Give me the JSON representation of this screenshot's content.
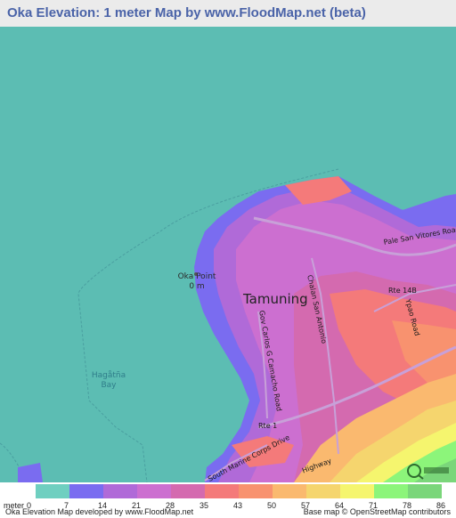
{
  "title": "Oka Elevation: 1 meter Map by www.FloodMap.net (beta)",
  "map": {
    "labels": {
      "point_name": "Oka Point",
      "point_elevation": "0 m",
      "bay": "Hagåtña\nBay",
      "city": "Tamuning"
    },
    "roads": {
      "pale_san_vitores": "Pale San Vitores Road",
      "chalan_san_antonio": "Chalan San Antonio",
      "gov_carlos": "Gov Carlos G Camacho Road",
      "rte_14b": "Rte 14B",
      "ypao": "Ypao Road",
      "rte_1": "Rte 1",
      "south_marine": "South Marine Corps Drive",
      "highway": "Highway"
    },
    "icons": [
      "osm-logo-icon"
    ]
  },
  "legend": {
    "unit_label": "meter",
    "ticks": [
      "0",
      "7",
      "14",
      "21",
      "28",
      "35",
      "43",
      "50",
      "57",
      "64",
      "71",
      "78",
      "86"
    ],
    "colors": [
      "#6fcfc0",
      "#7a6cf0",
      "#b06ad8",
      "#cc6fd0",
      "#d46aaf",
      "#f47a7a",
      "#f8926f",
      "#fab96f",
      "#f5d56e",
      "#f5f56e",
      "#8cf57a",
      "#7ad67a"
    ]
  },
  "footer": {
    "left": "Oka Elevation Map developed by www.FloodMap.net",
    "right": "Base map © OpenStreetMap contributors"
  }
}
